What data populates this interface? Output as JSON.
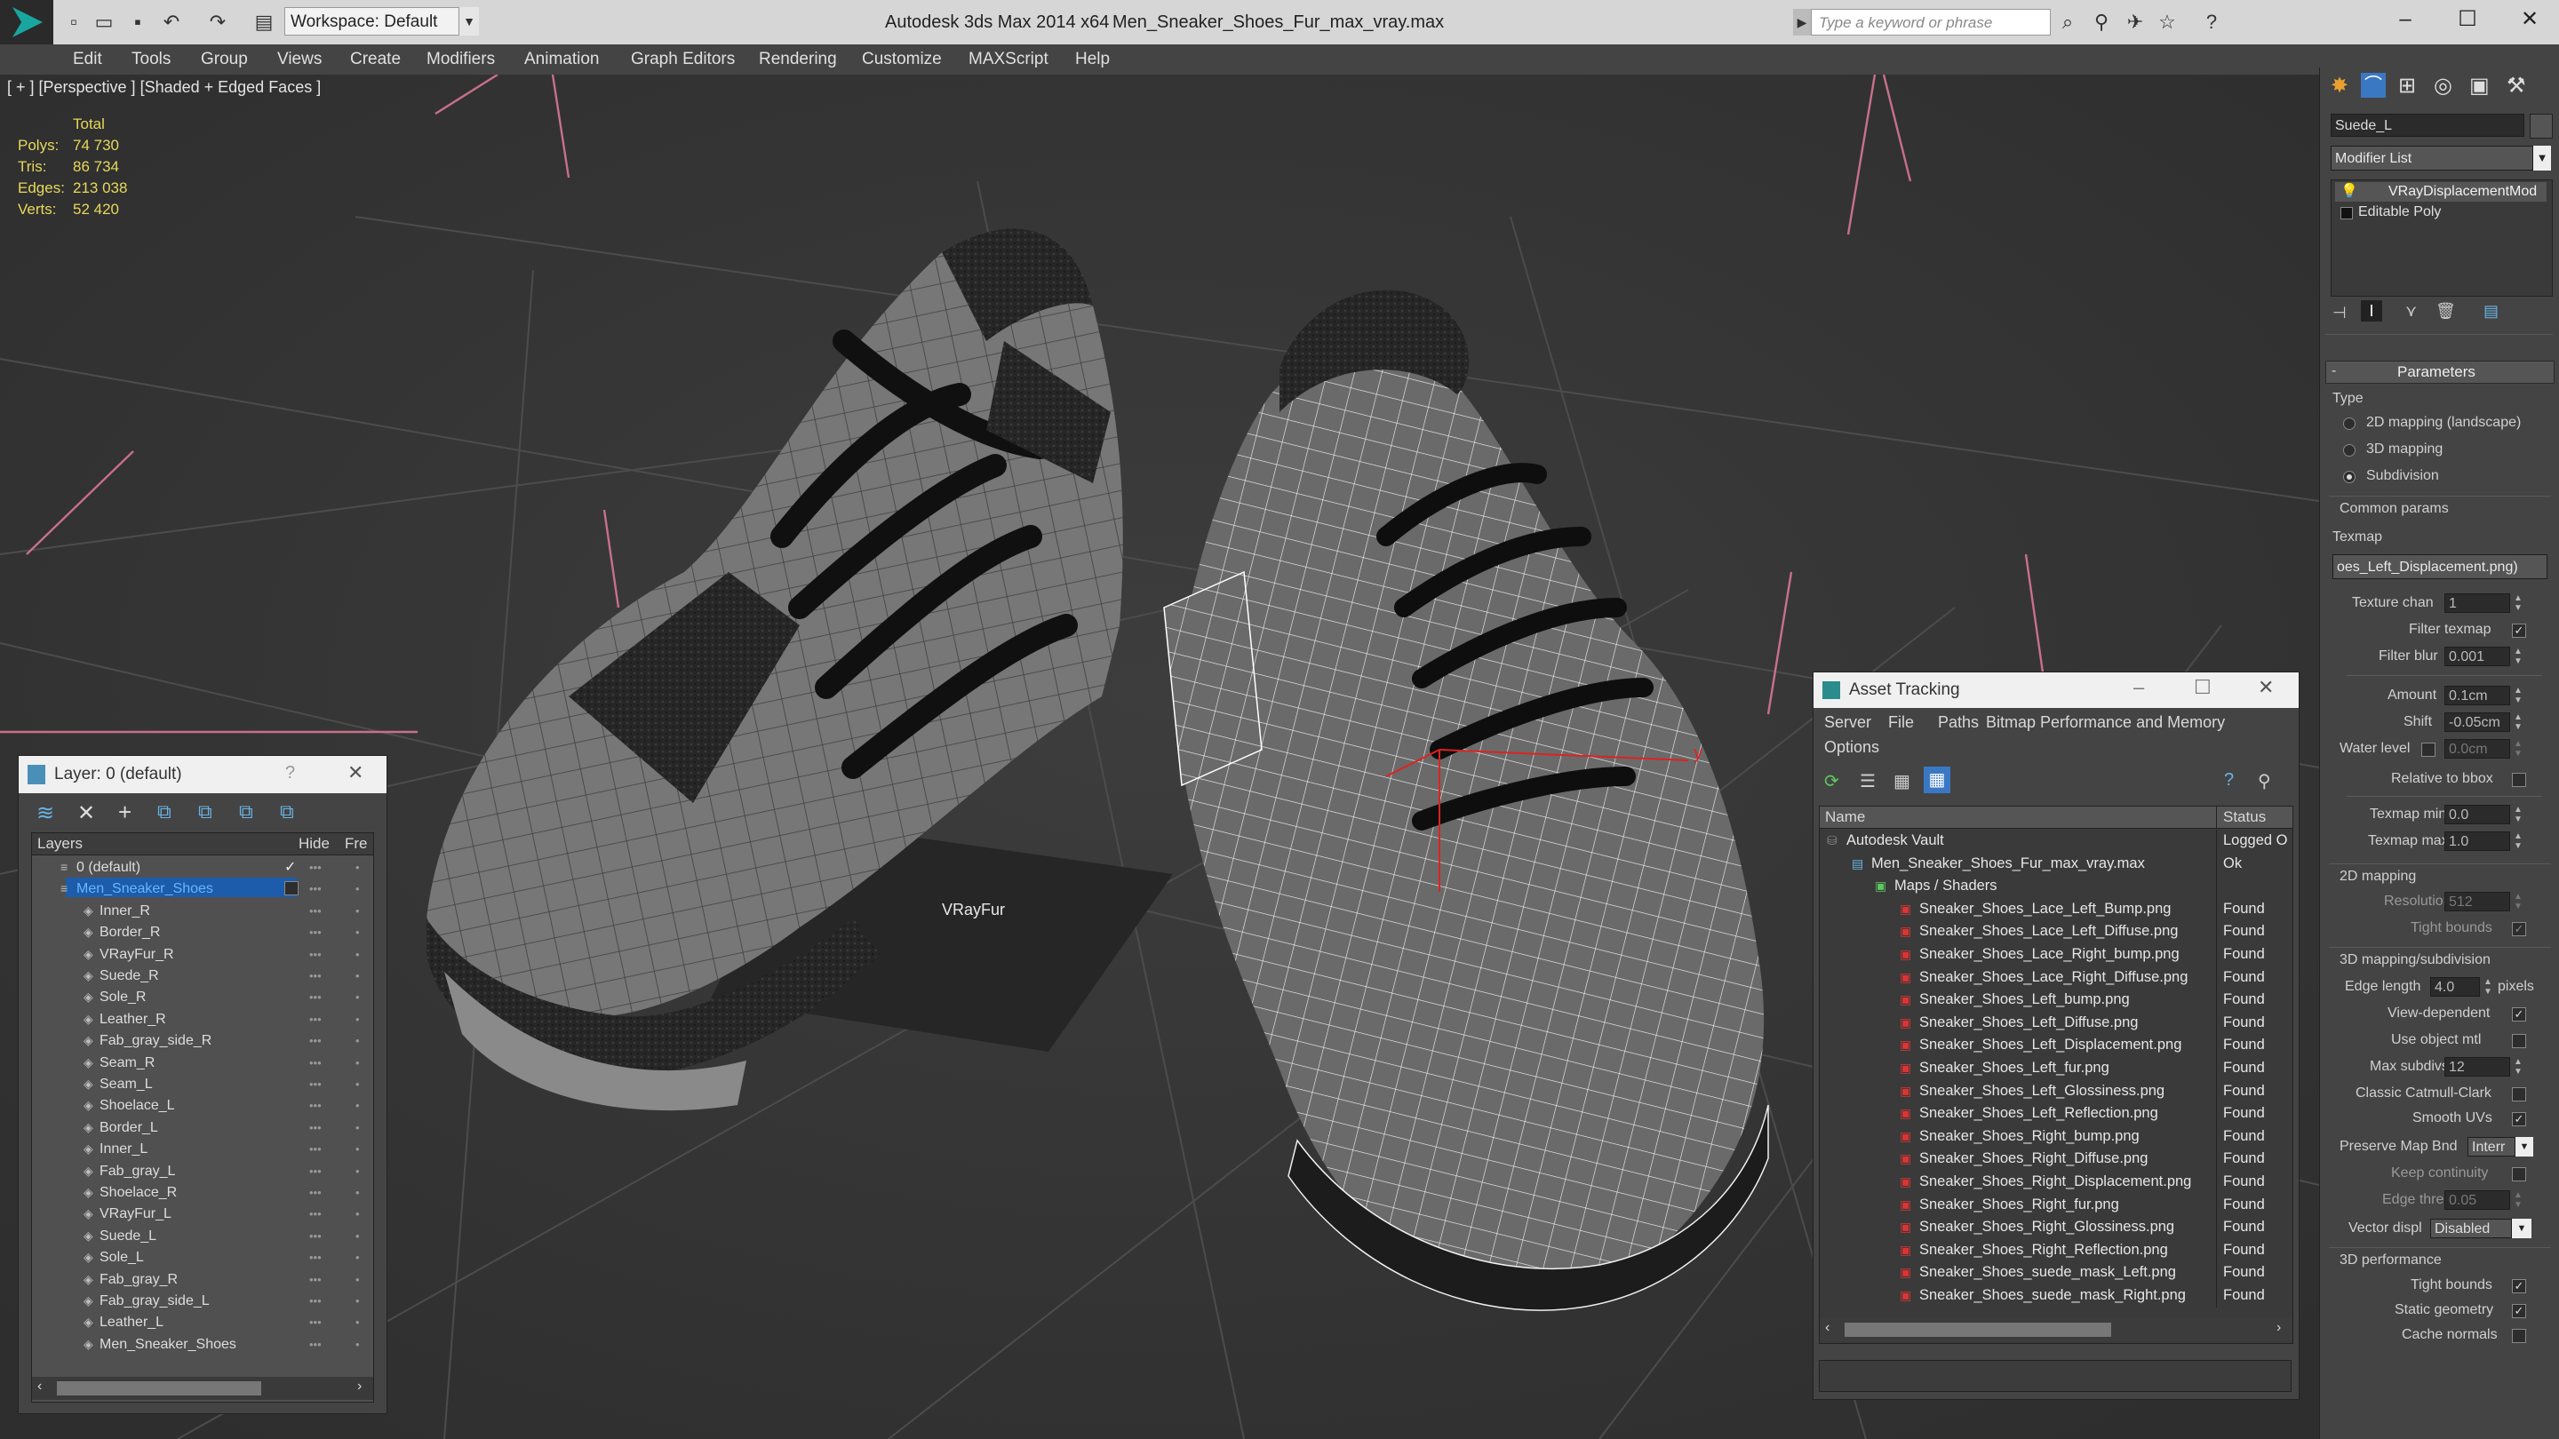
{
  "titlebar": {
    "workspace": "Workspace: Default",
    "app_name": "Autodesk 3ds Max  2014 x64",
    "document": "Men_Sneaker_Shoes_Fur_max_vray.max",
    "search_placeholder": "Type a keyword or phrase"
  },
  "menu": [
    "Edit",
    "Tools",
    "Group",
    "Views",
    "Create",
    "Modifiers",
    "Animation",
    "Graph Editors",
    "Rendering",
    "Customize",
    "MAXScript",
    "Help"
  ],
  "viewport": {
    "label": "[ + ] [Perspective ] [Shaded + Edged Faces ]",
    "stats": {
      "header": "Total",
      "rows": [
        {
          "label": "Polys:",
          "value": "74 730"
        },
        {
          "label": "Tris:",
          "value": "86 734"
        },
        {
          "label": "Edges:",
          "value": "213 038"
        },
        {
          "label": "Verts:",
          "value": "52 420"
        }
      ]
    },
    "fur_label": "VRayFur",
    "gizmo_axis": "y"
  },
  "layer_dialog": {
    "title": "Layer: 0 (default)",
    "help": "?",
    "columns": [
      "Layers",
      "Hide",
      "Fre"
    ],
    "rows": [
      {
        "name": "0 (default)",
        "level": 0,
        "kind": "layer"
      },
      {
        "name": "Men_Sneaker_Shoes",
        "level": 0,
        "kind": "layer",
        "selected": true
      },
      {
        "name": "Inner_R",
        "level": 1
      },
      {
        "name": "Border_R",
        "level": 1
      },
      {
        "name": "VRayFur_R",
        "level": 1
      },
      {
        "name": "Suede_R",
        "level": 1
      },
      {
        "name": "Sole_R",
        "level": 1
      },
      {
        "name": "Leather_R",
        "level": 1
      },
      {
        "name": "Fab_gray_side_R",
        "level": 1
      },
      {
        "name": "Seam_R",
        "level": 1
      },
      {
        "name": "Seam_L",
        "level": 1
      },
      {
        "name": "Shoelace_L",
        "level": 1
      },
      {
        "name": "Border_L",
        "level": 1
      },
      {
        "name": "Inner_L",
        "level": 1
      },
      {
        "name": "Fab_gray_L",
        "level": 1
      },
      {
        "name": "Shoelace_R",
        "level": 1
      },
      {
        "name": "VRayFur_L",
        "level": 1
      },
      {
        "name": "Suede_L",
        "level": 1
      },
      {
        "name": "Sole_L",
        "level": 1
      },
      {
        "name": "Fab_gray_R",
        "level": 1
      },
      {
        "name": "Fab_gray_side_L",
        "level": 1
      },
      {
        "name": "Leather_L",
        "level": 1
      },
      {
        "name": "Men_Sneaker_Shoes",
        "level": 1
      }
    ]
  },
  "asset_tracking": {
    "title": "Asset Tracking",
    "menu": [
      "Server",
      "File",
      "Paths",
      "Bitmap Performance and Memory",
      "Options"
    ],
    "columns": [
      "Name",
      "Status"
    ],
    "rows": [
      {
        "name": "Autodesk Vault",
        "status": "Logged O",
        "level": 0
      },
      {
        "name": "Men_Sneaker_Shoes_Fur_max_vray.max",
        "status": "Ok",
        "level": 1
      },
      {
        "name": "Maps / Shaders",
        "status": "",
        "level": 2
      },
      {
        "name": "Sneaker_Shoes_Lace_Left_Bump.png",
        "status": "Found",
        "level": 3
      },
      {
        "name": "Sneaker_Shoes_Lace_Left_Diffuse.png",
        "status": "Found",
        "level": 3
      },
      {
        "name": "Sneaker_Shoes_Lace_Right_bump.png",
        "status": "Found",
        "level": 3
      },
      {
        "name": "Sneaker_Shoes_Lace_Right_Diffuse.png",
        "status": "Found",
        "level": 3
      },
      {
        "name": "Sneaker_Shoes_Left_bump.png",
        "status": "Found",
        "level": 3
      },
      {
        "name": "Sneaker_Shoes_Left_Diffuse.png",
        "status": "Found",
        "level": 3
      },
      {
        "name": "Sneaker_Shoes_Left_Displacement.png",
        "status": "Found",
        "level": 3
      },
      {
        "name": "Sneaker_Shoes_Left_fur.png",
        "status": "Found",
        "level": 3
      },
      {
        "name": "Sneaker_Shoes_Left_Glossiness.png",
        "status": "Found",
        "level": 3
      },
      {
        "name": "Sneaker_Shoes_Left_Reflection.png",
        "status": "Found",
        "level": 3
      },
      {
        "name": "Sneaker_Shoes_Right_bump.png",
        "status": "Found",
        "level": 3
      },
      {
        "name": "Sneaker_Shoes_Right_Diffuse.png",
        "status": "Found",
        "level": 3
      },
      {
        "name": "Sneaker_Shoes_Right_Displacement.png",
        "status": "Found",
        "level": 3
      },
      {
        "name": "Sneaker_Shoes_Right_fur.png",
        "status": "Found",
        "level": 3
      },
      {
        "name": "Sneaker_Shoes_Right_Glossiness.png",
        "status": "Found",
        "level": 3
      },
      {
        "name": "Sneaker_Shoes_Right_Reflection.png",
        "status": "Found",
        "level": 3
      },
      {
        "name": "Sneaker_Shoes_suede_mask_Left.png",
        "status": "Found",
        "level": 3
      },
      {
        "name": "Sneaker_Shoes_suede_mask_Right.png",
        "status": "Found",
        "level": 3
      }
    ]
  },
  "command_panel": {
    "object_name": "Suede_L",
    "modifier_list": "Modifier List",
    "stack": [
      "VRayDisplacementMod",
      "Editable Poly"
    ],
    "rollout_title": "Parameters",
    "type_label": "Type",
    "type_options": [
      {
        "label": "2D mapping (landscape)",
        "selected": false
      },
      {
        "label": "3D mapping",
        "selected": false
      },
      {
        "label": "Subdivision",
        "selected": true
      }
    ],
    "common_params": "Common params",
    "texmap_label": "Texmap",
    "texmap_value": "oes_Left_Displacement.png)",
    "texture_chan": {
      "label": "Texture chan",
      "value": "1"
    },
    "filter_texmap": {
      "label": "Filter texmap",
      "checked": true
    },
    "filter_blur": {
      "label": "Filter blur",
      "value": "0.001"
    },
    "amount": {
      "label": "Amount",
      "value": "0.1cm"
    },
    "shift": {
      "label": "Shift",
      "value": "-0.05cm"
    },
    "water_level": {
      "label": "Water level",
      "value": "0.0cm"
    },
    "relative_bbox": {
      "label": "Relative to bbox"
    },
    "texmap_min": {
      "label": "Texmap min",
      "value": "0.0"
    },
    "texmap_max": {
      "label": "Texmap max",
      "value": "1.0"
    },
    "mapping_2d": "2D mapping",
    "resolution": {
      "label": "Resolution",
      "value": "512"
    },
    "tight_bounds_2d": {
      "label": "Tight bounds",
      "checked": true
    },
    "mapping_3d": "3D mapping/subdivision",
    "edge_length": {
      "label": "Edge length",
      "value": "4.0",
      "unit": "pixels"
    },
    "view_dependent": {
      "label": "View-dependent",
      "checked": true
    },
    "use_object_mtl": {
      "label": "Use object mtl",
      "checked": false
    },
    "max_subdivs": {
      "label": "Max subdivs",
      "value": "12"
    },
    "classic_catmull": {
      "label": "Classic Catmull-Clark",
      "checked": false
    },
    "smooth_uvs": {
      "label": "Smooth UVs",
      "checked": true
    },
    "preserve_map": {
      "label": "Preserve Map Bnd",
      "value": "Interr"
    },
    "keep_continuity": {
      "label": "Keep continuity",
      "checked": false
    },
    "edge_thresh": {
      "label": "Edge thresh",
      "value": "0.05"
    },
    "vector_displ": {
      "label": "Vector displ",
      "value": "Disabled"
    },
    "perf_3d": "3D performance",
    "tight_bounds": {
      "label": "Tight bounds",
      "checked": true
    },
    "static_geometry": {
      "label": "Static geometry",
      "checked": true
    },
    "cache_normals": {
      "label": "Cache normals",
      "checked": false
    }
  }
}
